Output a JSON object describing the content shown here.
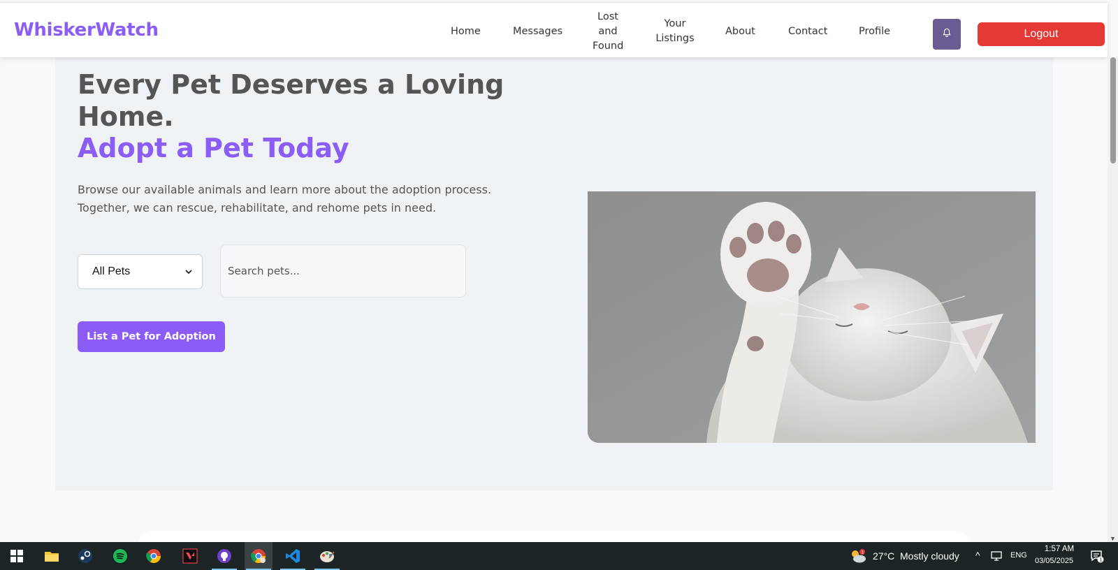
{
  "app": {
    "brand": "WhiskerWatch"
  },
  "nav": {
    "home": "Home",
    "messages": "Messages",
    "lost_found_1": "Lost",
    "lost_found_2": "and",
    "lost_found_3": "Found",
    "listings_1": "Your",
    "listings_2": "Listings",
    "about": "About",
    "contact": "Contact",
    "profile": "Profile",
    "notifications_icon": "bell-icon",
    "logout": "Logout"
  },
  "hero": {
    "headline": "Every Pet Deserves a Loving Home.",
    "headline_accent": "Adopt a Pet Today",
    "description": "Browse our available animals and learn more about the adoption process. Together, we can rescue, rehabilitate, and rehome pets in need.",
    "filter": {
      "selected": "All Pets"
    },
    "search": {
      "placeholder": "Search pets...",
      "value": ""
    },
    "cta_label": "List a Pet for Adoption",
    "image_alt": "white cat raising paw"
  },
  "taskbar": {
    "apps": [
      "windows-start",
      "file-explorer",
      "steam",
      "spotify",
      "chrome",
      "valorant",
      "github-desktop",
      "chrome-profile",
      "vscode",
      "paint"
    ],
    "weather": {
      "temp": "27°C",
      "condition": "Mostly cloudy",
      "badge": "1"
    },
    "language": "ENG",
    "time": "1:57 AM",
    "date": "03/05/2025",
    "notifications_count": "1"
  },
  "colors": {
    "accent": "#8b5cf6",
    "logout": "#e53935",
    "bell_button": "#6b5b93",
    "taskbar": "#1c2426"
  }
}
